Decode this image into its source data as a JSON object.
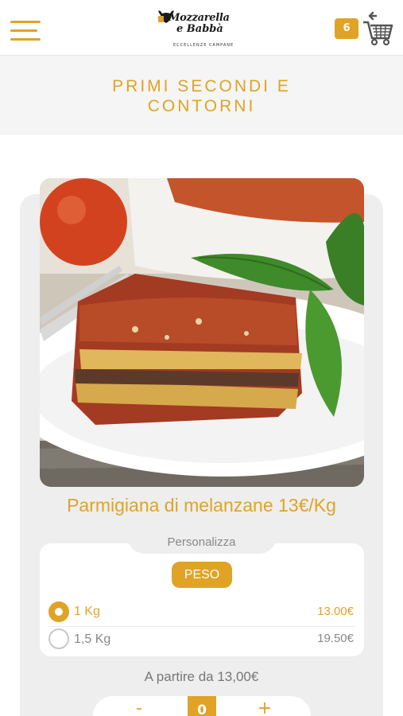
{
  "header": {
    "menu_icon": "hamburger-menu-icon",
    "logo": {
      "line1": "Mozzarella",
      "line2": "e Babbà",
      "tagline": "ECCELLENZE CAMPANE"
    },
    "cart_count": "6",
    "cart_icon": "shopping-cart-back-icon"
  },
  "category": {
    "title_line1": "PRIMI SECONDI E",
    "title_line2": "CONTORNI"
  },
  "product": {
    "image_alt": "Parmigiana di melanzane",
    "title": "Parmigiana di melanzane 13€/Kg",
    "customize_label": "Personalizza",
    "group_label": "PESO",
    "options": [
      {
        "label": "1 Kg",
        "price": "13.00€",
        "selected": true
      },
      {
        "label": "1,5 Kg",
        "price": "19.50€",
        "selected": false
      }
    ],
    "from_price": "A partire da 13,00€",
    "quantity": {
      "minus": "-",
      "value": "0",
      "plus": "+"
    }
  },
  "colors": {
    "accent": "#e0a325",
    "band": "#f5f5f5",
    "card": "#eeeeee"
  }
}
